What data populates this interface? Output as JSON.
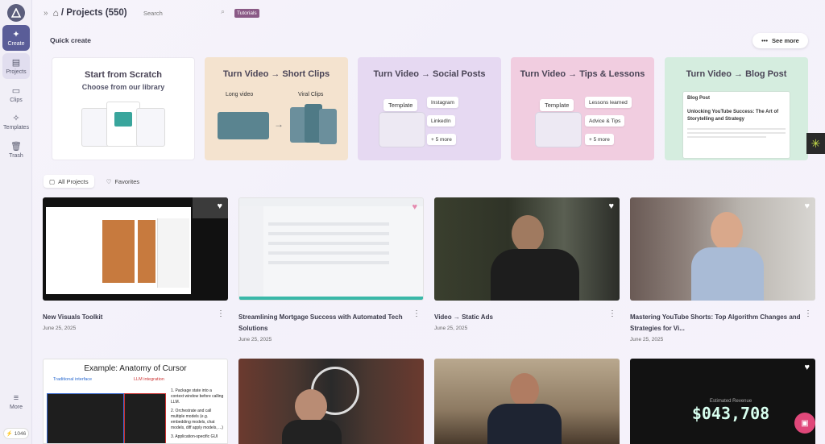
{
  "sidebar": {
    "items": [
      {
        "label": "Create",
        "icon": "sparkle-icon"
      },
      {
        "label": "Projects",
        "icon": "projects-icon"
      },
      {
        "label": "Clips",
        "icon": "clips-icon"
      },
      {
        "label": "Templates",
        "icon": "templates-icon"
      },
      {
        "label": "Trash",
        "icon": "trash-icon"
      }
    ],
    "more": "More",
    "credits": "1046"
  },
  "header": {
    "title": "/ Projects (550)",
    "search_placeholder": "Search",
    "tutorials": "Tutorials"
  },
  "quick_create": {
    "label": "Quick create",
    "see_more": "See more",
    "cards": [
      {
        "title": "Start from Scratch",
        "subtitle": "Choose from our library"
      },
      {
        "title": "Turn Video → Short Clips",
        "left_label": "Long video",
        "right_label": "Viral Clips"
      },
      {
        "title": "Turn Video → Social Posts",
        "template": "Template",
        "pills": [
          "Instagram",
          "LinkedIn",
          "+ 5 more"
        ]
      },
      {
        "title": "Turn Video → Tips & Lessons",
        "template": "Template",
        "pills": [
          "Lessons learned",
          "Advice & Tips",
          "+ 5 more"
        ]
      },
      {
        "title": "Turn Video → Blog Post",
        "blog_label": "Blog Post",
        "blog_heading": "Unlocking YouTube Success: The Art of Storytelling and Strategy"
      }
    ]
  },
  "filters": {
    "all": "All Projects",
    "favorites": "Favorites"
  },
  "projects": [
    {
      "title": "New Visuals Toolkit",
      "date": "June 25, 2025"
    },
    {
      "title": "Streamlining Mortgage Success with Automated Tech Solutions",
      "date": "June 25, 2025"
    },
    {
      "title": "Video → Static Ads",
      "date": "June 25, 2025"
    },
    {
      "title": "Mastering YouTube Shorts: Top Algorithm Changes and Strategies for Vi...",
      "date": "June 25, 2025"
    }
  ],
  "row2": {
    "slide_title": "Example: Anatomy of Cursor",
    "slide_left": "Traditional interface",
    "slide_right": "LLM integration",
    "slide_points": [
      "1. Package state into a context window before calling LLM.",
      "2. Orchestrate and call multiple models (e.g. embedding models, chat models, diff apply models, ...)",
      "3. Application-specific GUI"
    ],
    "revenue_label": "Estimated Revenue",
    "revenue_value": "$043,708"
  }
}
